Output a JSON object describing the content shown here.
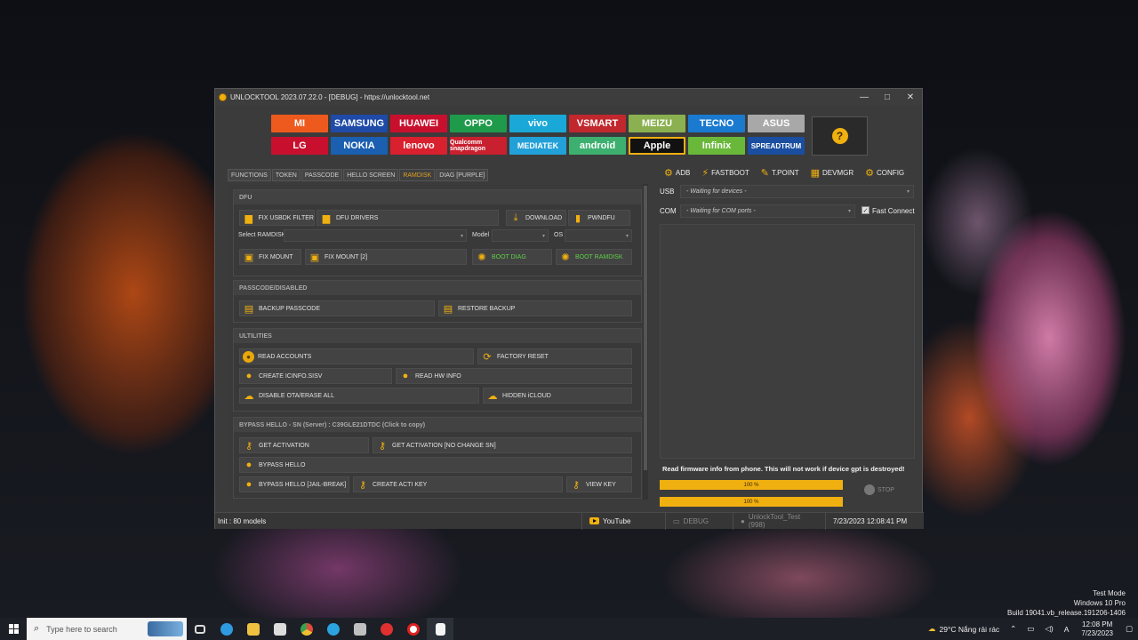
{
  "window": {
    "title": "UNLOCKTOOL 2023.07.22.0 - [DEBUG] - https://unlocktool.net",
    "controls": [
      "—",
      "□",
      "✕"
    ]
  },
  "brands": [
    {
      "label": "MI",
      "color": "#ee5a1d"
    },
    {
      "label": "SAMSUNG",
      "color": "#1f4aa8"
    },
    {
      "label": "HUAWEI",
      "color": "#c8102e"
    },
    {
      "label": "OPPO",
      "color": "#1f9a4a"
    },
    {
      "label": "vivo",
      "color": "#19a8d8"
    },
    {
      "label": "VSMART",
      "color": "#c0282e"
    },
    {
      "label": "MEIZU",
      "color": "#8ab050"
    },
    {
      "label": "TECNO",
      "color": "#1a7ad0"
    },
    {
      "label": "ASUS",
      "color": "#a8a8a8"
    },
    {
      "label": "LG",
      "color": "#c8102e"
    },
    {
      "label": "NOKIA",
      "color": "#1a5fb0"
    },
    {
      "label": "lenovo",
      "color": "#d8202e"
    },
    {
      "label": "Qualcomm snapdragon",
      "color": "#c8202e"
    },
    {
      "label": "MEDIATEK",
      "color": "#22a0d8"
    },
    {
      "label": "android",
      "color": "#3db070"
    },
    {
      "label": "Apple",
      "color": "#111111"
    },
    {
      "label": "Infinix",
      "color": "#6ab83a"
    },
    {
      "label": "SPREADTRUM",
      "color": "#1a4ea0"
    }
  ],
  "help_icon": "question-icon",
  "tabs": [
    "FUNCTIONS",
    "TOKEN",
    "PASSCODE",
    "HELLO SCREEN",
    "RAMDISK",
    "DIAG [PURPLE]"
  ],
  "sections": {
    "dfu": {
      "title": "DFU",
      "fix_usbdk": "FIX USBDK FILTER",
      "dfu_drivers": "DFU DRIVERS",
      "download": "DOWNLOAD",
      "pwndfu": "PWNDFU",
      "select_ramdisk": "Select RAMDISK",
      "model": "Model",
      "os": "OS",
      "fix_mount": "FIX MOUNT",
      "fix_mount_2": "FIX MOUNT [2]",
      "boot_diag": "BOOT DIAG",
      "boot_ramdisk": "BOOT RAMDISK"
    },
    "passcode": {
      "title": "PASSCODE/DISABLED",
      "backup": "BACKUP PASSCODE",
      "restore": "RESTORE BACKUP"
    },
    "utilities": {
      "title": "ULTILITIES",
      "read_accounts": "READ ACCOUNTS",
      "factory_reset": "FACTORY RESET",
      "create_icinfo": "CREATE ICINFO.SISV",
      "read_hw": "READ HW INFO",
      "disable_ota": "DISABLE OTA/ERASE ALL",
      "hidden_icloud": "HIDDEN iCLOUD"
    },
    "bypass": {
      "title": "BYPASS HELLO - SN (Server) : C39GLE21DTDC (Click to copy)",
      "get_activation": "GET ACTIVATION",
      "get_activation_nc": "GET ACTIVATION [NO CHANGE SN]",
      "bypass_hello": "BYPASS HELLO",
      "bypass_jb": "BYPASS HELLO [JAIL-BREAK]",
      "create_acti": "CREATE ACTI KEY",
      "view_key": "VIEW KEY"
    }
  },
  "right": {
    "toolbar": [
      "ADB",
      "FASTBOOT",
      "T.POINT",
      "DEVMGR",
      "CONFIG"
    ],
    "usb_label": "USB",
    "usb_value": "- Waiting for devices -",
    "com_label": "COM",
    "com_value": "- Waiting for COM ports -",
    "fast_connect": "Fast Connect",
    "info": "Read firmware info from phone. This will not work if device gpt is destroyed!",
    "progress1": "100 %",
    "progress2": "100 %",
    "progress1_value": 1.0,
    "progress2_value": 1.0,
    "stop": "STOP"
  },
  "status": {
    "init": "Init : 80 models",
    "youtube": "YouTube",
    "debug": "DEBUG",
    "user": "UnlockTool_Test (998)",
    "datetime": "7/23/2023 12:08:41 PM"
  },
  "watermark": [
    "Test Mode",
    "Windows 10 Pro",
    "Build 19041.vb_release.191206-1406"
  ],
  "taskbar": {
    "search_placeholder": "Type here to search",
    "apps": [
      {
        "name": "task-view-icon",
        "color": "#dddddd"
      },
      {
        "name": "edge-icon",
        "color": "#2f9ae0"
      },
      {
        "name": "file-explorer-icon",
        "color": "#f0c040"
      },
      {
        "name": "store-icon",
        "color": "#dddddd"
      },
      {
        "name": "chrome-icon",
        "color": "#e04a3a"
      },
      {
        "name": "telegram-icon",
        "color": "#2aa3e0"
      },
      {
        "name": "app-icon",
        "color": "#c0c0c0"
      },
      {
        "name": "d-app-icon",
        "color": "#e03030"
      },
      {
        "name": "record-icon",
        "color": "#e02020"
      },
      {
        "name": "document-icon",
        "color": "#f5f5f5"
      }
    ],
    "weather": "29°C  Nắng rải rác",
    "time": "12:08 PM",
    "date": "7/23/2023"
  }
}
